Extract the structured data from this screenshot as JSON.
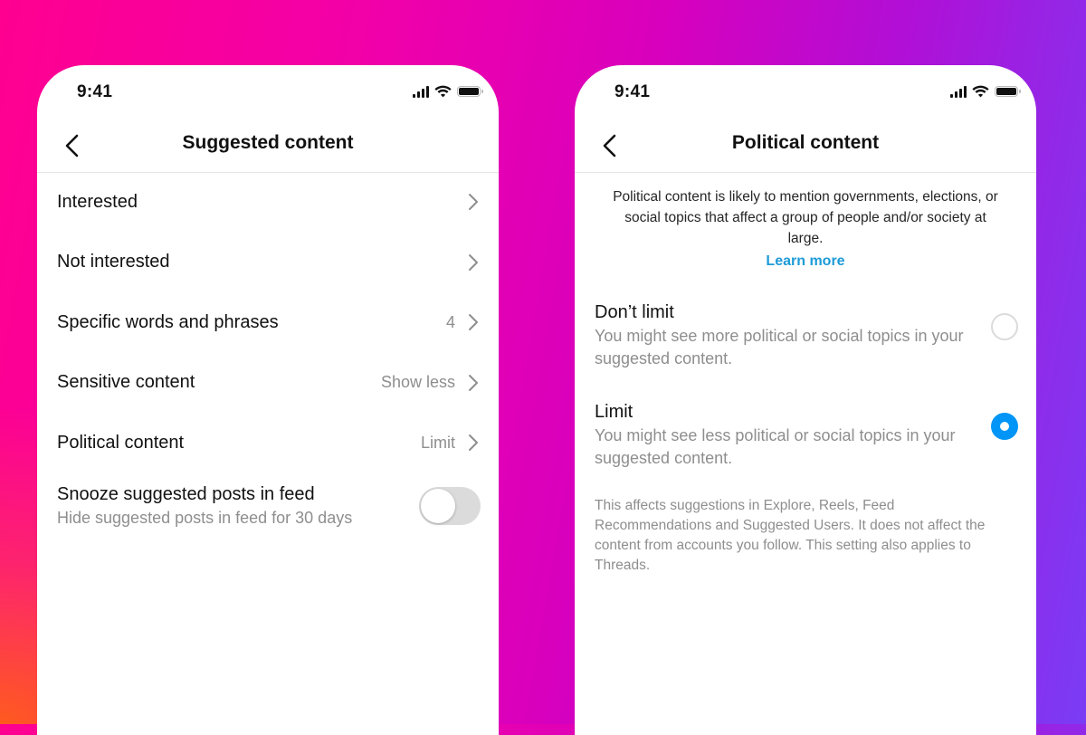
{
  "background": {
    "gradient_colors": [
      "#ff0090",
      "#d800bd",
      "#7a3cf5",
      "#ff5a1f"
    ]
  },
  "left_phone": {
    "status_bar": {
      "time": "9:41",
      "icons": [
        "cellular-signal-icon",
        "wifi-icon",
        "battery-icon"
      ]
    },
    "header": {
      "back_icon": "chevron-left-icon",
      "title": "Suggested content"
    },
    "items": [
      {
        "label": "Interested",
        "value": "",
        "icon": "chevron-right-icon"
      },
      {
        "label": "Not interested",
        "value": "",
        "icon": "chevron-right-icon"
      },
      {
        "label": "Specific words and phrases",
        "value": "4",
        "icon": "chevron-right-icon"
      },
      {
        "label": "Sensitive content",
        "value": "Show less",
        "icon": "chevron-right-icon"
      },
      {
        "label": "Political content",
        "value": "Limit",
        "icon": "chevron-right-icon"
      }
    ],
    "snooze": {
      "label": "Snooze suggested posts in feed",
      "sublabel": "Hide suggested posts in feed for 30 days",
      "enabled": false
    }
  },
  "right_phone": {
    "status_bar": {
      "time": "9:41",
      "icons": [
        "cellular-signal-icon",
        "wifi-icon",
        "battery-icon"
      ]
    },
    "header": {
      "back_icon": "chevron-left-icon",
      "title": "Political content"
    },
    "intro": "Political content is likely to mention governments, elections, or social topics that affect a group of people and/or society at large.",
    "learn_more": "Learn more",
    "options": [
      {
        "title": "Don’t limit",
        "description": "You might see more political or social topics in your suggested content.",
        "selected": false
      },
      {
        "title": "Limit",
        "description": "You might see less political or social topics in your suggested content.",
        "selected": true
      }
    ],
    "footnote": "This affects suggestions in Explore, Reels, Feed Recommendations and Suggested Users. It does not affect the content from accounts you follow. This setting also applies to Threads.",
    "accent_color": "#0095f6",
    "link_color": "#1d9bd7"
  }
}
